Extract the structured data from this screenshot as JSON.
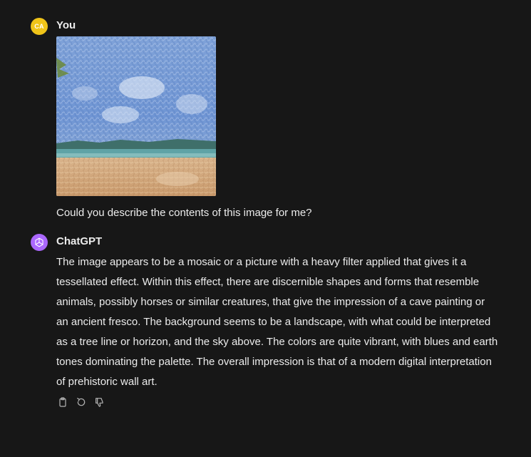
{
  "conversation": {
    "user": {
      "avatar_initials": "CA",
      "avatar_color": "#f0c419",
      "name": "You",
      "image_icon": "mosaic-beach-image",
      "prompt": "Could you describe the contents of this image for me?"
    },
    "assistant": {
      "avatar_icon": "chatgpt-logo-icon",
      "avatar_color": "#ab68ff",
      "name": "ChatGPT",
      "response": "The image appears to be a mosaic or a picture with a heavy filter applied that gives it a tessellated effect. Within this effect, there are discernible shapes and forms that resemble animals, possibly horses or similar creatures, that give the impression of a cave painting or an ancient fresco. The background seems to be a landscape, with what could be interpreted as a tree line or horizon, and the sky above. The colors are quite vibrant, with blues and earth tones dominating the palette. The overall impression is that of a modern digital interpretation of prehistoric wall art.",
      "actions": [
        {
          "icon": "clipboard-icon"
        },
        {
          "icon": "regenerate-icon"
        },
        {
          "icon": "thumbs-down-icon"
        }
      ]
    }
  },
  "colors": {
    "background": "#171717",
    "text": "#ececec",
    "icon": "#b4b4b4"
  }
}
